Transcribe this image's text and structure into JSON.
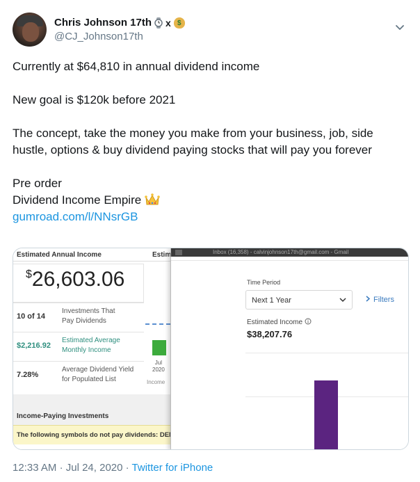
{
  "user": {
    "display_name": "Chris Johnson 17th",
    "name_suffix_x": "x",
    "handle": "@CJ_Johnson17th",
    "emoji": [
      "watch-icon",
      "money-bag-icon"
    ]
  },
  "tweet": {
    "line1": "Currently at $64,810 in annual dividend income",
    "line2": "New goal is $120k before 2021",
    "line3": "The concept, take the money you make from your business, job, side hustle, options & buy dividend paying stocks that will pay you forever",
    "line4a": "Pre order",
    "line4b": "Dividend Income Empire",
    "link": "gumroad.com/l/NNsrGB"
  },
  "media": {
    "left": {
      "title": "Estimated Annual Income",
      "title_cut": "Estim",
      "amount_symbol": "$",
      "amount": "26,603.06",
      "rows": [
        {
          "value": "10 of 14",
          "desc_line1": "Investments That",
          "desc_line2": "Pay Dividends"
        },
        {
          "value": "$2,216.92",
          "desc_line1": "Estimated Average",
          "desc_line2": "Monthly Income"
        },
        {
          "value": "7.28%",
          "desc_line1": "Average Dividend Yield",
          "desc_line2": "for Populated List"
        }
      ],
      "mini_month": "Jul",
      "mini_year": "2020",
      "mini_caption": "Income",
      "section_title": "Income-Paying Investments",
      "notice": "The following symbols do not pay dividends: DEN"
    },
    "right": {
      "browser_tab": "Inbox (16,358) - calvinjohnson17th@gmail.com - Gmail",
      "time_period_label": "Time Period",
      "time_period_value": "Next 1 Year",
      "filters_label": "Filters",
      "estimated_income_label": "Estimated Income",
      "estimated_income_value": "$38,207.76",
      "bar_color": "#5b2480"
    }
  },
  "meta": {
    "time": "12:33 AM",
    "sep1": "·",
    "date": "Jul 24, 2020",
    "sep2": "·",
    "via": "Twitter for iPhone"
  }
}
